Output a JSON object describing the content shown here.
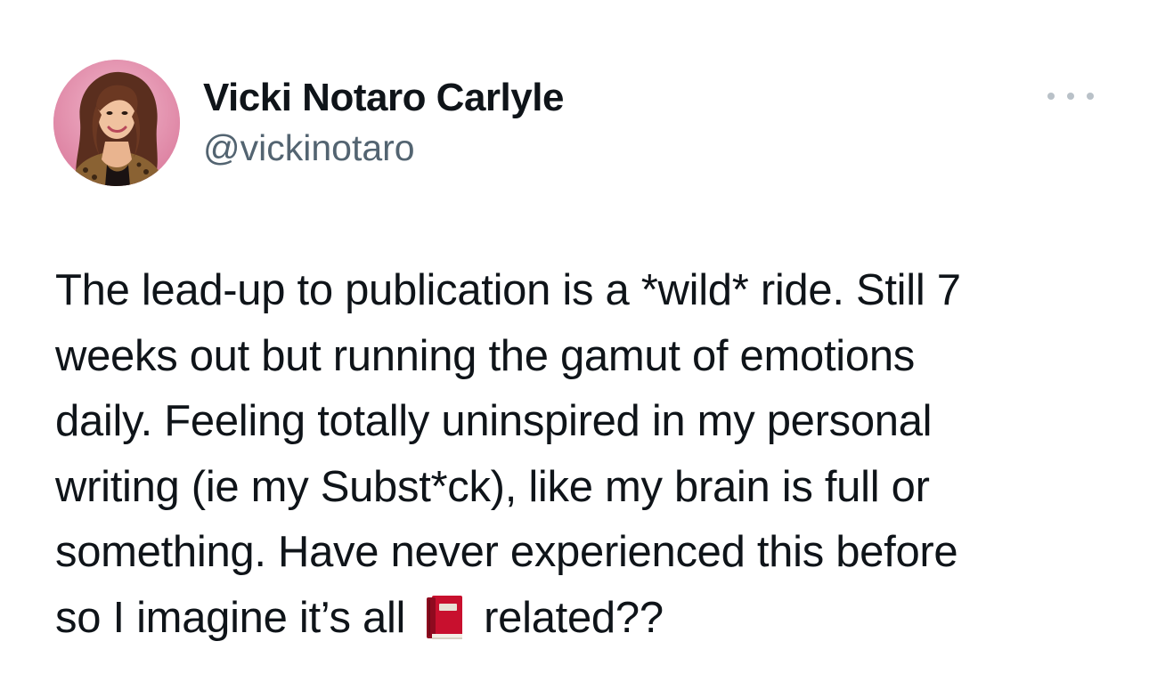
{
  "author": {
    "display_name": "Vicki Notaro Carlyle",
    "handle": "@vickinotaro",
    "avatar_icon": "profile-photo"
  },
  "menu": {
    "more_icon": "more-dots-icon"
  },
  "tweet": {
    "lines": [
      "The lead-up to publication is a *wild* ride. Still 7",
      "weeks out but running the gamut of emotions",
      "daily. Feeling totally uninspired in my personal",
      "writing (ie my Subst*ck), like my brain is full or",
      "something. Have never experienced this before"
    ],
    "last_line_before_emoji": "so I imagine it’s all",
    "emoji_icon": "red-book-emoji",
    "last_line_after_emoji": "related??"
  },
  "colors": {
    "text": "#0f1419",
    "secondary": "#536471",
    "dots": "#b9c1c8",
    "book": "#c8102e"
  }
}
